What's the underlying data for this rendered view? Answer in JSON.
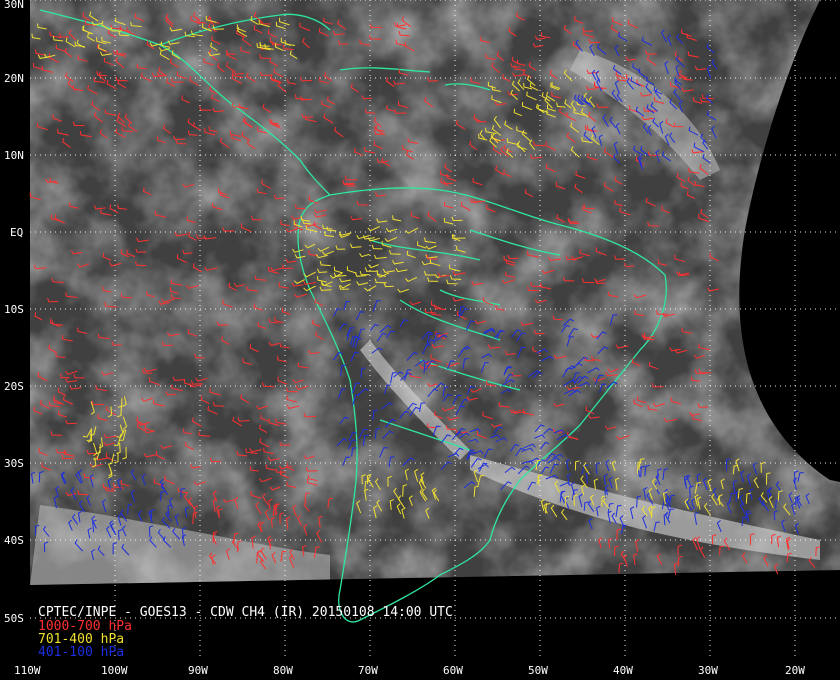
{
  "title": "CPTEC/INPE - GOES13 - CDW CH4 (IR) 20150108 14:00 UTC",
  "legend": [
    {
      "label": "1000-700 hPa",
      "color": "#ff3030"
    },
    {
      "label": "701-400 hPa",
      "color": "#f0e030"
    },
    {
      "label": "401-100 hPa",
      "color": "#1c2ee0"
    }
  ],
  "lat_labels": [
    "30N",
    "20N",
    "10N",
    "EQ",
    "10S",
    "20S",
    "30S",
    "40S",
    "50S"
  ],
  "lon_labels": [
    "110W",
    "100W",
    "90W",
    "80W",
    "70W",
    "60W",
    "50W",
    "40W",
    "30W",
    "20W"
  ],
  "colors": {
    "background": "#000000",
    "cloud_field": "#3a3a3a",
    "coastline": "#2ee8a0",
    "grid": "#ffffff",
    "text": "#ffffff"
  }
}
